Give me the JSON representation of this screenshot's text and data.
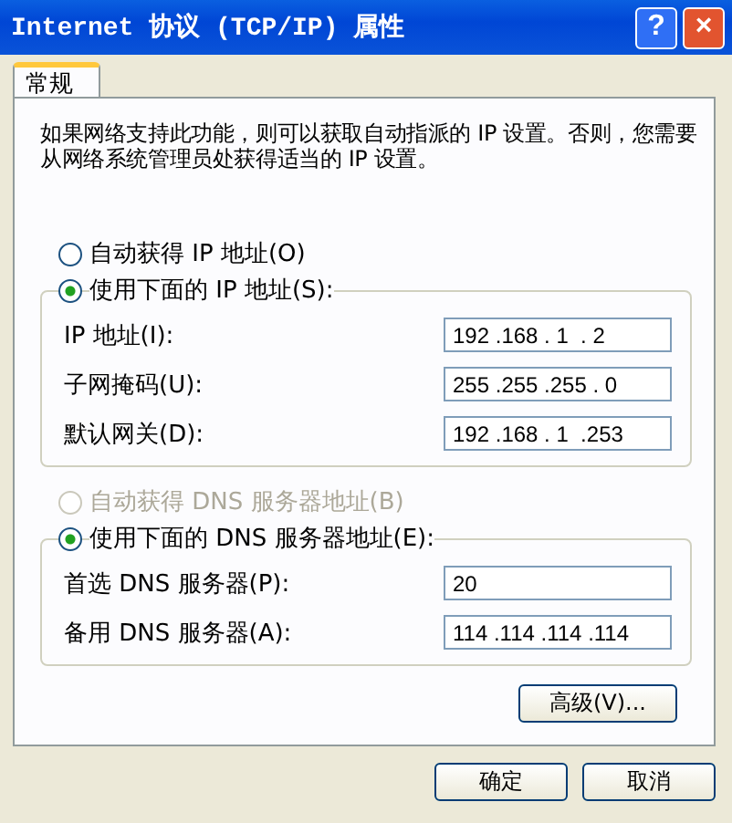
{
  "window": {
    "title": "Internet 协议 (TCP/IP) 属性",
    "help": "?",
    "close": "×"
  },
  "tabs": [
    {
      "label": "常规",
      "selected": true
    }
  ],
  "description": "如果网络支持此功能，则可以获取自动指派的 IP 设置。否则，您需要从网络系统管理员处获得适当的 IP 设置。",
  "ip_mode": [
    {
      "label": "自动获得 IP 地址(O)",
      "selected": false,
      "disabled": false
    },
    {
      "label": "使用下面的 IP 地址(S):",
      "selected": true,
      "disabled": false
    }
  ],
  "ip_fields": [
    {
      "label": "IP 地址(I):",
      "value": "192 .168 . 1  . 2"
    },
    {
      "label": "子网掩码(U):",
      "value": "255 .255 .255 . 0"
    },
    {
      "label": "默认网关(D):",
      "value": "192 .168 . 1  .253"
    }
  ],
  "dns_mode": [
    {
      "label": "自动获得 DNS 服务器地址(B)",
      "selected": false,
      "disabled": true
    },
    {
      "label": "使用下面的 DNS 服务器地址(E):",
      "selected": true,
      "disabled": false
    }
  ],
  "dns_fields": [
    {
      "label": "首选 DNS 服务器(P):",
      "value": "20"
    },
    {
      "label": "备用 DNS 服务器(A):",
      "value": "114 .114 .114 .114"
    }
  ],
  "advanced_button": "高级(V)...",
  "buttons": [
    "确定",
    "取消"
  ]
}
